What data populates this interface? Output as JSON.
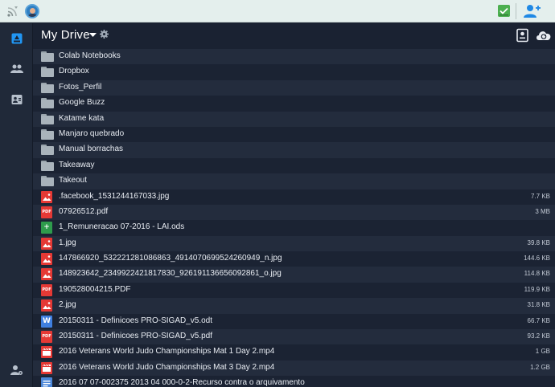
{
  "header": {
    "title": "My Drive"
  },
  "files": [
    {
      "name": "Colab Notebooks",
      "size": "",
      "type": "folder"
    },
    {
      "name": "Dropbox",
      "size": "",
      "type": "folder"
    },
    {
      "name": "Fotos_Perfil",
      "size": "",
      "type": "folder"
    },
    {
      "name": "Google Buzz",
      "size": "",
      "type": "folder"
    },
    {
      "name": "Katame kata",
      "size": "",
      "type": "folder"
    },
    {
      "name": "Manjaro quebrado",
      "size": "",
      "type": "folder"
    },
    {
      "name": "Manual borrachas",
      "size": "",
      "type": "folder"
    },
    {
      "name": "Takeaway",
      "size": "",
      "type": "folder"
    },
    {
      "name": "Takeout",
      "size": "",
      "type": "folder"
    },
    {
      "name": ".facebook_1531244167033.jpg",
      "size": "7.7 KB",
      "type": "image"
    },
    {
      "name": "07926512.pdf",
      "size": "3 MB",
      "type": "pdf"
    },
    {
      "name": "1_Remuneracao 07-2016 - LAI.ods",
      "size": "",
      "type": "sheet"
    },
    {
      "name": "1.jpg",
      "size": "39.8 KB",
      "type": "image"
    },
    {
      "name": "147866920_532221281086863_4914070699524260949_n.jpg",
      "size": "144.6 KB",
      "type": "image"
    },
    {
      "name": "148923642_2349922421817830_926191136656092861_o.jpg",
      "size": "114.8 KB",
      "type": "image"
    },
    {
      "name": "190528004215.PDF",
      "size": "119.9 KB",
      "type": "pdf"
    },
    {
      "name": "2.jpg",
      "size": "31.8 KB",
      "type": "image"
    },
    {
      "name": "20150311 - Definicoes PRO-SIGAD_v5.odt",
      "size": "66.7 KB",
      "type": "doc"
    },
    {
      "name": "20150311 - Definicoes PRO-SIGAD_v5.pdf",
      "size": "93.2 KB",
      "type": "pdf"
    },
    {
      "name": "2016 Veterans World Judo Championships Mat 1 Day 2.mp4",
      "size": "1 GB",
      "type": "video"
    },
    {
      "name": "2016 Veterans World Judo Championships Mat 3 Day 2.mp4",
      "size": "1.2 GB",
      "type": "video"
    },
    {
      "name": "2016 07 07-002375 2013 04 000-0-2-Recurso contra o arquivamento",
      "size": "",
      "type": "text"
    }
  ],
  "icon_labels": {
    "pdf": "PDF",
    "doc": "W",
    "sheet": "+"
  },
  "colors": {
    "accent": "#2196f3",
    "folder": "#a9b3bb",
    "file_red": "#e53935",
    "sheet_green": "#2e9b4c",
    "doc_blue": "#3f7fe0"
  }
}
